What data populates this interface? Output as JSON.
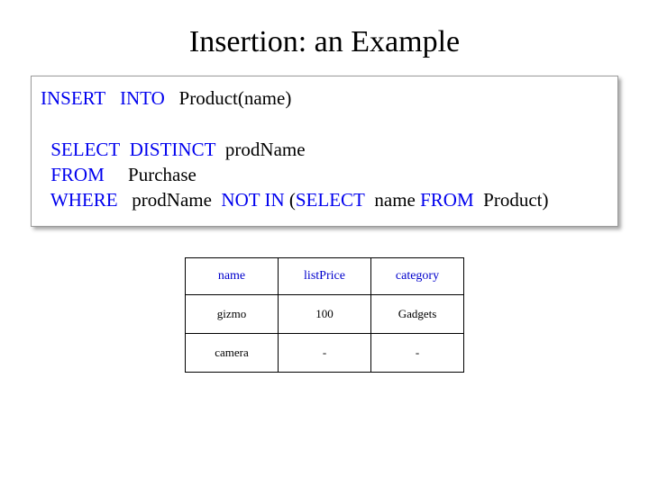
{
  "title": "Insertion: an Example",
  "sql": {
    "insert": "INSERT",
    "into": "INTO",
    "target": "Product(name)",
    "select": "SELECT",
    "distinct": "DISTINCT",
    "sel_col": "prodName",
    "from": "FROM",
    "from_tbl": "Purchase",
    "where": "WHERE",
    "where_col": "prodName",
    "not_in": "NOT IN",
    "lparen": "(",
    "sub_select": "SELECT",
    "sub_col": "name",
    "sub_from": "FROM",
    "sub_tbl": "Product)",
    "rparen": ""
  },
  "table": {
    "headers": [
      "name",
      "listPrice",
      "category"
    ],
    "rows": [
      [
        "gizmo",
        "100",
        "Gadgets"
      ],
      [
        "camera",
        "-",
        "-"
      ]
    ]
  }
}
